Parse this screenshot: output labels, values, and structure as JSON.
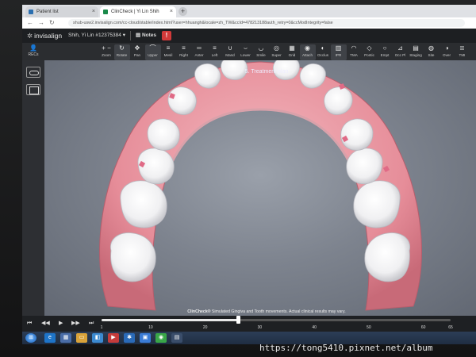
{
  "browser": {
    "tabs": [
      {
        "title": "Patient list",
        "color": "#2b6fb0"
      },
      {
        "title": "ClinCheck | Yi Lin Shih",
        "color": "#1a8a4a"
      }
    ],
    "new_tab": "+",
    "url": "shub-usw2.invisalign.com/cc-cloud/stable/index.html?user=hhuangh&locale=zh_TW&ccId=478213188auth_retry=0&ccModIntegrity=false"
  },
  "app": {
    "brand": "invisalign",
    "patient": "Shih, Yi Lin #12375384",
    "patient_menu": "▾",
    "notes": "Notes",
    "warning": "!"
  },
  "toolbar": [
    {
      "icon": "plus-minus-icon",
      "glyph": "+ −",
      "label": "Zoom"
    },
    {
      "icon": "rotate-icon",
      "glyph": "↻",
      "label": "Rotate",
      "active": true
    },
    {
      "icon": "pan-icon",
      "glyph": "✥",
      "label": "Pan"
    },
    {
      "icon": "upper-jaw-icon",
      "glyph": "⌒",
      "label": "Upper",
      "active": true
    },
    {
      "icon": "mesial-view-icon",
      "glyph": "≡",
      "label": "Mesil"
    },
    {
      "icon": "right-view-icon",
      "glyph": "≡",
      "label": "Right"
    },
    {
      "icon": "anterior-view-icon",
      "glyph": "═",
      "label": "Anter"
    },
    {
      "icon": "left-view-icon",
      "glyph": "≡",
      "label": "Left"
    },
    {
      "icon": "mandible-icon",
      "glyph": "∪",
      "label": "Mand"
    },
    {
      "icon": "lower-jaw-icon",
      "glyph": "⌣",
      "label": "Lower"
    },
    {
      "icon": "smile-icon",
      "glyph": "◡",
      "label": "Smile"
    },
    {
      "icon": "superimpose-icon",
      "glyph": "◎",
      "label": "Super"
    },
    {
      "icon": "grid-icon",
      "glyph": "▦",
      "label": "Grid"
    },
    {
      "icon": "attach-icon",
      "glyph": "◉",
      "label": "Attach",
      "active": true
    },
    {
      "icon": "occlusal-icon",
      "glyph": "◐",
      "label": "Occlus"
    },
    {
      "icon": "ipr-icon",
      "glyph": "▥",
      "label": "IPR",
      "active": true
    },
    {
      "icon": "tma-icon",
      "glyph": "◠",
      "label": "TMA"
    },
    {
      "icon": "pontic-icon",
      "glyph": "◇",
      "label": "Pontic"
    },
    {
      "icon": "empty-icon",
      "glyph": "○",
      "label": "Empt"
    },
    {
      "icon": "occ-plane-icon",
      "glyph": "⊿",
      "label": "Occ Pl"
    },
    {
      "icon": "staging-icon",
      "glyph": "▤",
      "label": "Staging"
    },
    {
      "icon": "site-icon",
      "glyph": "◍",
      "label": "Site"
    },
    {
      "icon": "overlay-icon",
      "glyph": "◑",
      "label": "Over"
    },
    {
      "icon": "tmi-icon",
      "glyph": "≣",
      "label": "TMI"
    }
  ],
  "left_panel": {
    "recs_label": "RECs"
  },
  "viewport": {
    "title": "5. Treatment plan",
    "disclaimer_brand": "ClinCheck®",
    "disclaimer": " Simulated Gingiva and Tooth movements. Actual clinical results may vary."
  },
  "timeline": {
    "ticks": [
      "1",
      "10",
      "20",
      "30",
      "40",
      "50",
      "60",
      "65"
    ],
    "current_stage": 26,
    "max_stage": 65
  },
  "watermark": "https://tong5410.pixnet.net/album"
}
